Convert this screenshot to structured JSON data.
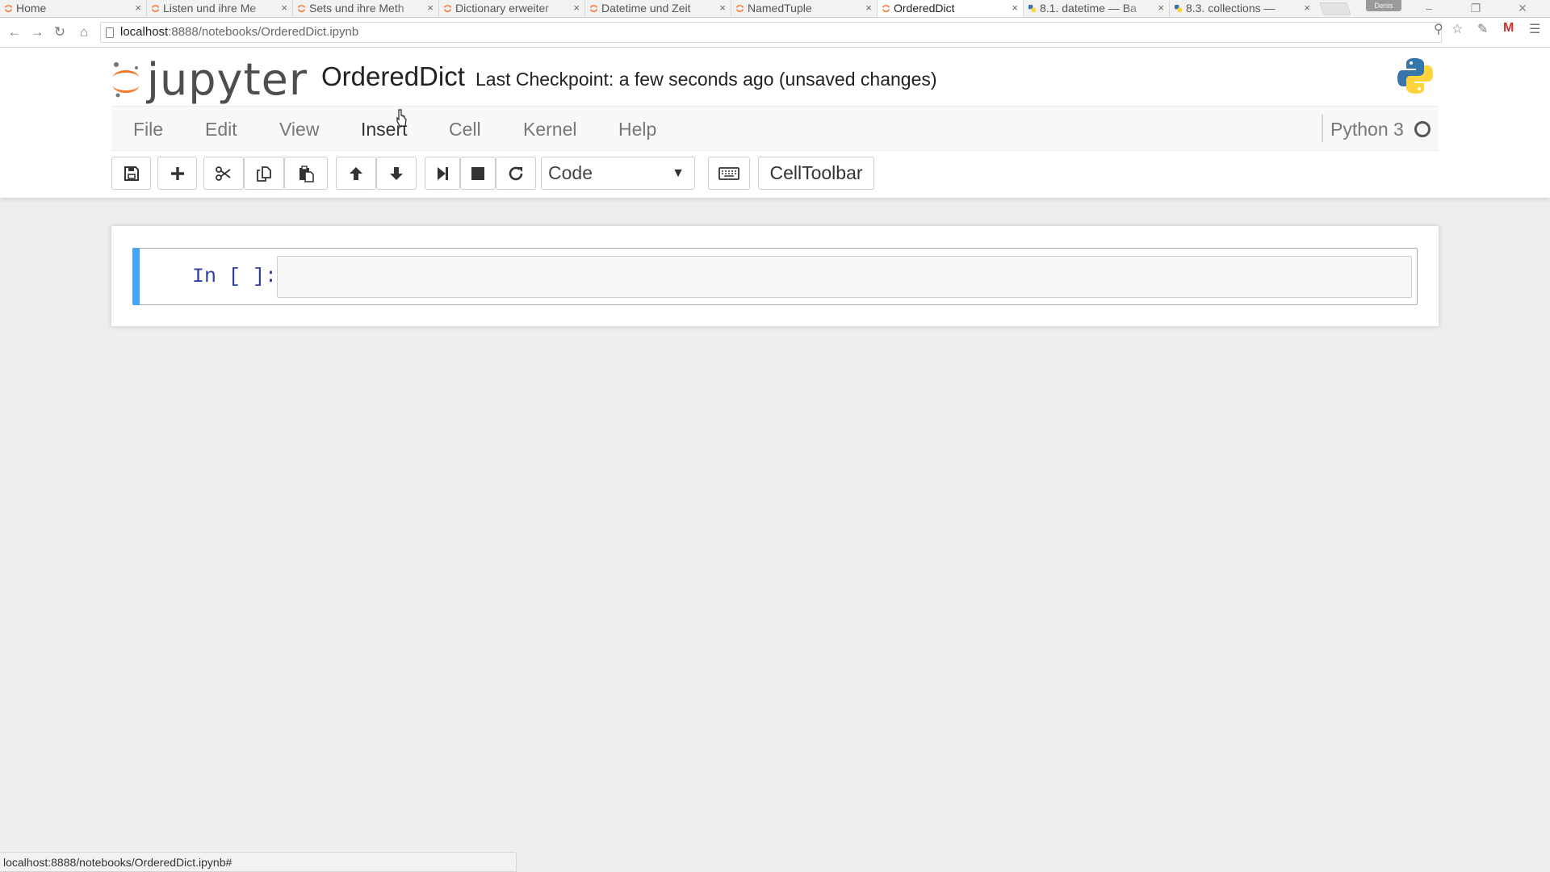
{
  "browser": {
    "tabs": [
      {
        "label": "Home",
        "favicon": "jupyter-icon",
        "active": false
      },
      {
        "label": "Listen und ihre Me",
        "favicon": "jupyter-icon",
        "active": false
      },
      {
        "label": "Sets und ihre Meth",
        "favicon": "jupyter-icon",
        "active": false
      },
      {
        "label": "Dictionary erweiter",
        "favicon": "jupyter-icon",
        "active": false
      },
      {
        "label": "Datetime und Zeit",
        "favicon": "jupyter-icon",
        "active": false
      },
      {
        "label": "NamedTuple",
        "favicon": "jupyter-icon",
        "active": false
      },
      {
        "label": "OrderedDict",
        "favicon": "jupyter-icon",
        "active": true
      },
      {
        "label": "8.1. datetime — Ba",
        "favicon": "python-icon",
        "active": false
      },
      {
        "label": "8.3. collections — ",
        "favicon": "python-icon",
        "active": false
      }
    ],
    "tab_close_glyph": "×",
    "profile_name": "Denis",
    "url_host": "localhost",
    "url_path": ":8888/notebooks/OrderedDict.ipynb",
    "status_url": "localhost:8888/notebooks/OrderedDict.ipynb#"
  },
  "jupyter": {
    "logo_text": "jupyter",
    "notebook_name": "OrderedDict",
    "checkpoint": "Last Checkpoint: a few seconds ago (unsaved changes)",
    "menu": [
      "File",
      "Edit",
      "View",
      "Insert",
      "Cell",
      "Kernel",
      "Help"
    ],
    "kernel_name": "Python 3",
    "cell_type": "Code",
    "celltoolbar_label": "CellToolbar",
    "cell_prompt": "In [ ]:",
    "colors": {
      "accent_blue": "#42a5f5",
      "logo_orange": "#f37726",
      "prompt_blue": "#303f9f"
    }
  }
}
